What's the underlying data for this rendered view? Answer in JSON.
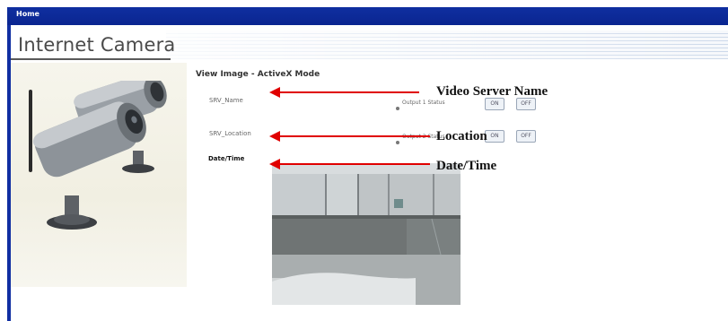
{
  "window": {
    "title": "Home"
  },
  "header": {
    "app_title": "Internet Camera"
  },
  "main": {
    "section_title": "View Image - ActiveX Mode",
    "server_name_value": "SRV_Name",
    "location_value": "SRV_Location",
    "datetime_value": "Date/Time",
    "output1": {
      "label": "Output 1 Status",
      "on_label": "ON",
      "off_label": "OFF"
    },
    "output2": {
      "label": "Output 2 Status",
      "on_label": "ON",
      "off_label": "OFF"
    }
  },
  "annotations": {
    "server_name": "Video Server  Name",
    "location": "Location",
    "date_time": "Date/Time"
  },
  "colors": {
    "title_bar": "#0f2fa0",
    "arrow": "#e00000"
  },
  "icons": {
    "camera_image": "ip-camera-photo"
  }
}
